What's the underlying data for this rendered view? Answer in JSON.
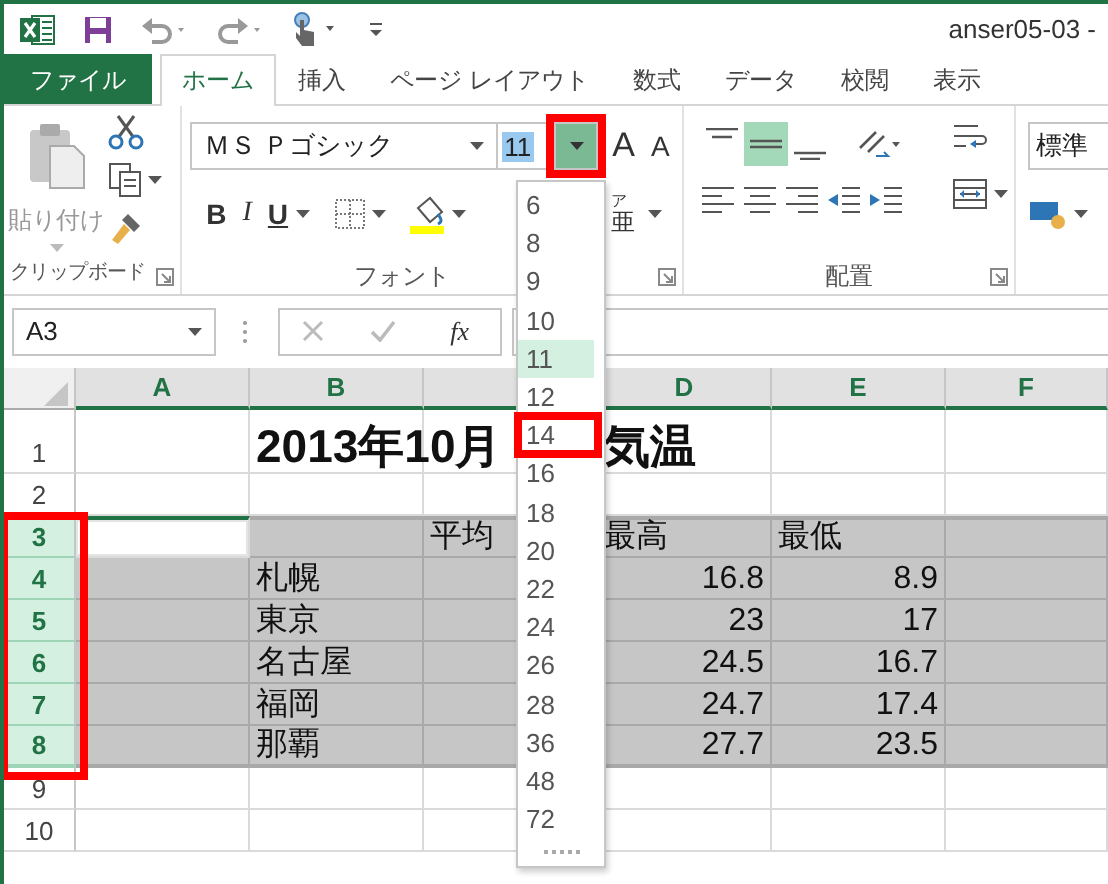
{
  "window": {
    "title": "anser05-03 -"
  },
  "tabs": [
    {
      "label": "ファイル",
      "kind": "file",
      "selected": false
    },
    {
      "label": "ホーム",
      "kind": "tab",
      "selected": true
    },
    {
      "label": "挿入",
      "kind": "tab",
      "selected": false
    },
    {
      "label": "ページ レイアウト",
      "kind": "tab",
      "selected": false
    },
    {
      "label": "数式",
      "kind": "tab",
      "selected": false
    },
    {
      "label": "データ",
      "kind": "tab",
      "selected": false
    },
    {
      "label": "校閲",
      "kind": "tab",
      "selected": false
    },
    {
      "label": "表示",
      "kind": "tab",
      "selected": false
    }
  ],
  "ribbon": {
    "clipboard": {
      "paste": "貼り付け",
      "label": "クリップボード"
    },
    "font": {
      "font_name": "ＭＳ Ｐゴシック",
      "font_size": "11",
      "font_size_highlighted": true,
      "size_button_annotated": true,
      "grow": "A",
      "shrink": "A",
      "bold": "B",
      "italic": "I",
      "underline": "U",
      "phonetic_small": "ア",
      "phonetic_large": "亜",
      "label": "フォント"
    },
    "alignment": {
      "label": "配置",
      "vertical_align_buttons": [
        {
          "selected": false
        },
        {
          "selected": true
        },
        {
          "selected": false
        }
      ]
    },
    "number": {
      "format": "標準"
    }
  },
  "formula_bar": {
    "name_box": "A3",
    "function_label": "fx"
  },
  "font_size_list": {
    "items": [
      {
        "label": "6",
        "selected": false,
        "annotated": false
      },
      {
        "label": "8",
        "selected": false,
        "annotated": false
      },
      {
        "label": "9",
        "selected": false,
        "annotated": false
      },
      {
        "label": "10",
        "selected": false,
        "annotated": false
      },
      {
        "label": "11",
        "selected": true,
        "annotated": false
      },
      {
        "label": "12",
        "selected": false,
        "annotated": false
      },
      {
        "label": "14",
        "selected": false,
        "annotated": true
      },
      {
        "label": "16",
        "selected": false,
        "annotated": false
      },
      {
        "label": "18",
        "selected": false,
        "annotated": false
      },
      {
        "label": "20",
        "selected": false,
        "annotated": false
      },
      {
        "label": "22",
        "selected": false,
        "annotated": false
      },
      {
        "label": "24",
        "selected": false,
        "annotated": false
      },
      {
        "label": "26",
        "selected": false,
        "annotated": false
      },
      {
        "label": "28",
        "selected": false,
        "annotated": false
      },
      {
        "label": "36",
        "selected": false,
        "annotated": false
      },
      {
        "label": "48",
        "selected": false,
        "annotated": false
      },
      {
        "label": "72",
        "selected": false,
        "annotated": false
      }
    ]
  },
  "sheet": {
    "columns": [
      {
        "label": "A",
        "selected": true
      },
      {
        "label": "B",
        "selected": true
      },
      {
        "selected": true
      },
      {
        "label": "D",
        "selected": true
      },
      {
        "label": "E",
        "selected": true
      },
      {
        "label": "F",
        "selected": true
      }
    ],
    "rows": [
      {
        "header": "1",
        "kind": "title",
        "selected": false,
        "active": false,
        "annotated": false,
        "cells": [
          null,
          {
            "text": "2013年10月",
            "kind": "title"
          },
          null,
          {
            "text": "気温",
            "kind": "title"
          },
          null,
          null
        ]
      },
      {
        "header": "2",
        "kind": "plain",
        "selected": false,
        "active": false,
        "annotated": false
      },
      {
        "header": "3",
        "kind": "plain",
        "selected": true,
        "active": true,
        "annotated": true,
        "cells": [
          null,
          null,
          {
            "text": "平均",
            "kind": "text"
          },
          {
            "text": "最高",
            "kind": "text"
          },
          {
            "text": "最低",
            "kind": "text"
          },
          null
        ]
      },
      {
        "header": "4",
        "kind": "plain",
        "selected": true,
        "active": false,
        "annotated": true,
        "cells": [
          null,
          {
            "text": "札幌",
            "kind": "text"
          },
          null,
          {
            "text": "16.8",
            "kind": "number"
          },
          {
            "text": "8.9",
            "kind": "number"
          },
          null
        ]
      },
      {
        "header": "5",
        "kind": "plain",
        "selected": true,
        "active": false,
        "annotated": true,
        "cells": [
          null,
          {
            "text": "東京",
            "kind": "text"
          },
          null,
          {
            "text": "23",
            "kind": "number"
          },
          {
            "text": "17",
            "kind": "number"
          },
          null
        ]
      },
      {
        "header": "6",
        "kind": "plain",
        "selected": true,
        "active": false,
        "annotated": true,
        "cells": [
          null,
          {
            "text": "名古屋",
            "kind": "text"
          },
          null,
          {
            "text": "24.5",
            "kind": "number"
          },
          {
            "text": "16.7",
            "kind": "number"
          },
          null
        ]
      },
      {
        "header": "7",
        "kind": "plain",
        "selected": true,
        "active": false,
        "annotated": true,
        "cells": [
          null,
          {
            "text": "福岡",
            "kind": "text"
          },
          null,
          {
            "text": "24.7",
            "kind": "number"
          },
          {
            "text": "17.4",
            "kind": "number"
          },
          null
        ]
      },
      {
        "header": "8",
        "kind": "plain",
        "selected": true,
        "active": false,
        "annotated": true,
        "cells": [
          null,
          {
            "text": "那覇",
            "kind": "text"
          },
          null,
          {
            "text": "27.7",
            "kind": "number"
          },
          {
            "text": "23.5",
            "kind": "number"
          },
          null
        ]
      },
      {
        "header": "9",
        "kind": "plain",
        "selected": false,
        "active": false,
        "annotated": false
      },
      {
        "header": "10",
        "kind": "plain",
        "selected": false,
        "active": false,
        "annotated": false
      }
    ]
  }
}
